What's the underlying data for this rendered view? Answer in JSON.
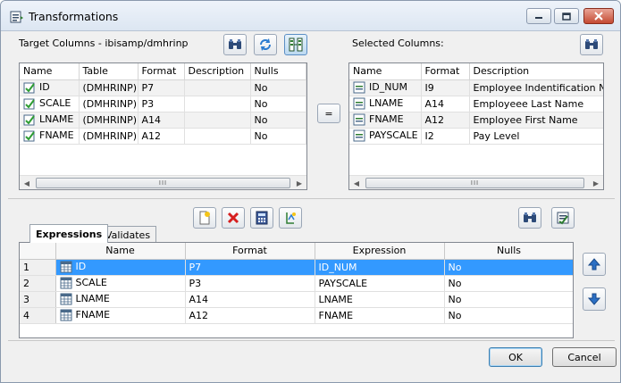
{
  "window": {
    "title": "Transformations"
  },
  "target": {
    "label": "Target Columns - ibisamp/dmhrinp",
    "columns": [
      "Name",
      "Table",
      "Format",
      "Description",
      "Nulls"
    ],
    "rows": [
      {
        "name": "ID",
        "table": "(DMHRINP)",
        "format": "P7",
        "description": "",
        "nulls": "No"
      },
      {
        "name": "SCALE",
        "table": "(DMHRINP)",
        "format": "P3",
        "description": "",
        "nulls": "No"
      },
      {
        "name": "LNAME",
        "table": "(DMHRINP)",
        "format": "A14",
        "description": "",
        "nulls": "No"
      },
      {
        "name": "FNAME",
        "table": "(DMHRINP)",
        "format": "A12",
        "description": "",
        "nulls": "No"
      }
    ],
    "scroll_thumb_text": "III"
  },
  "equals_button": "=",
  "selected": {
    "label": "Selected Columns:",
    "columns": [
      "Name",
      "Format",
      "Description"
    ],
    "rows": [
      {
        "name": "ID_NUM",
        "format": "I9",
        "description": "Employee Indentification Numb"
      },
      {
        "name": "LNAME",
        "format": "A14",
        "description": "Employeee Last Name"
      },
      {
        "name": "FNAME",
        "format": "A12",
        "description": "Employee First Name"
      },
      {
        "name": "PAYSCALE",
        "format": "I2",
        "description": "Pay Level"
      }
    ],
    "scroll_thumb_text": "III"
  },
  "tabs": [
    "Expressions",
    "Validates"
  ],
  "expressions": {
    "columns": [
      "Name",
      "Format",
      "Expression",
      "Nulls"
    ],
    "rows": [
      {
        "num": "1",
        "name": "ID",
        "format": "P7",
        "expression": "ID_NUM",
        "nulls": "No"
      },
      {
        "num": "2",
        "name": "SCALE",
        "format": "P3",
        "expression": "PAYSCALE",
        "nulls": "No"
      },
      {
        "num": "3",
        "name": "LNAME",
        "format": "A14",
        "expression": "LNAME",
        "nulls": "No"
      },
      {
        "num": "4",
        "name": "FNAME",
        "format": "A12",
        "expression": "FNAME",
        "nulls": "No"
      }
    ],
    "selected_row": 0
  },
  "buttons": {
    "ok": "OK",
    "cancel": "Cancel"
  },
  "colors": {
    "selection": "#3399ff",
    "close_button": "#c44a32"
  }
}
